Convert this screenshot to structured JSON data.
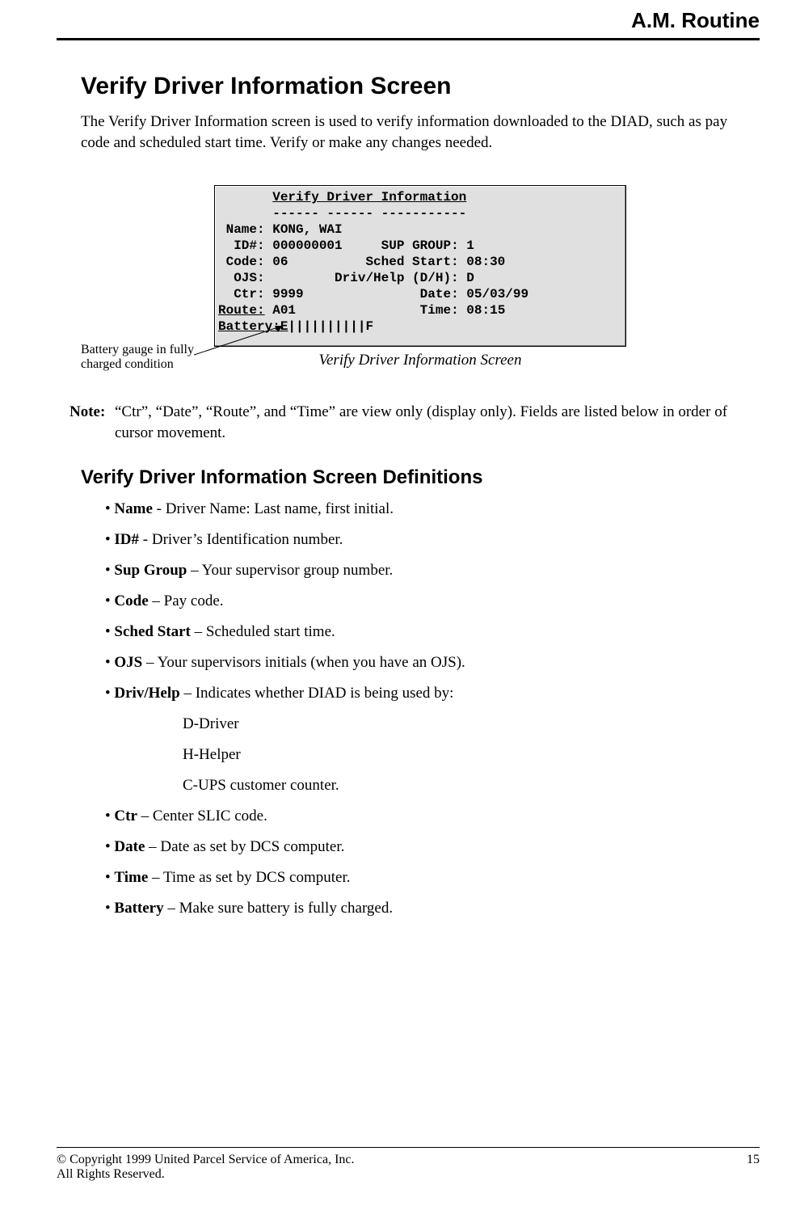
{
  "running_head": "A.M. Routine",
  "title": "Verify Driver Information Screen",
  "lead": "The Verify Driver Information screen is used to verify information downloaded to the DIAD, such as pay code and scheduled start time. Verify or make any changes needed.",
  "term": {
    "title": "Verify Driver Information",
    "dashes": "------ ------ -----------",
    "name_lbl": " Name:",
    "name_val": "KONG, WAI",
    "id_lbl": "  ID#:",
    "id_val": "000000001",
    "sup_lbl": "SUP GROUP:",
    "sup_val": "1",
    "code_lbl": " Code:",
    "code_val": "06",
    "start_lbl": "Sched Start:",
    "start_val": "08:30",
    "ojs_lbl": "  OJS:",
    "ojs_val": "",
    "dh_lbl": "Driv/Help (D/H):",
    "dh_val": "D",
    "ctr_lbl": "  Ctr:",
    "ctr_val": "9999",
    "date_lbl": "Date:",
    "date_val": "05/03/99",
    "route_lbl": "Route:",
    "route_val": "A01",
    "time_lbl": "Time:",
    "time_val": "08:15",
    "batt_lbl": "Battery:",
    "batt_e": "E",
    "batt_bar": "||||||||||",
    "batt_f": "F"
  },
  "fig_caption": "Verify Driver Information Screen",
  "callout": "Battery gauge in fully charged condition",
  "note_label": "Note:",
  "note_text": "“Ctr”, “Date”, “Route”, and “Time” are view only (display only). Fields are listed below in order of cursor movement.",
  "subhead": "Verify Driver Information Screen Definitions",
  "defs": [
    {
      "term": "Name",
      "sep": " - ",
      "text": "Driver Name: Last name, first initial."
    },
    {
      "term": "ID#",
      "sep": " - ",
      "text": "Driver’s Identification number."
    },
    {
      "term": "Sup Group",
      "sep": " – ",
      "text": "Your supervisor group number."
    },
    {
      "term": "Code",
      "sep": " – ",
      "text": "Pay code."
    },
    {
      "term": "Sched Start",
      "sep": " – ",
      "text": "Scheduled start time."
    },
    {
      "term": "OJS",
      "sep": " – ",
      "text": "Your supervisors initials (when you have an OJS)."
    },
    {
      "term": "Driv/Help",
      "sep": " – ",
      "text": "Indicates whether DIAD is being used by:",
      "sub": [
        "D-Driver",
        "H-Helper",
        "C-UPS customer counter."
      ]
    },
    {
      "term": "Ctr",
      "sep": " – ",
      "text": "Center SLIC code."
    },
    {
      "term": "Date",
      "sep": " – ",
      "text": "Date as set by DCS computer."
    },
    {
      "term": "Time",
      "sep": " – ",
      "text": "Time as set by DCS computer."
    },
    {
      "term": "Battery",
      "sep": " – ",
      "text": "Make sure battery is fully charged."
    }
  ],
  "footer": {
    "copyright": "© Copyright 1999 United Parcel Service of America, Inc.",
    "rights": "All Rights Reserved.",
    "page_no": "15"
  }
}
